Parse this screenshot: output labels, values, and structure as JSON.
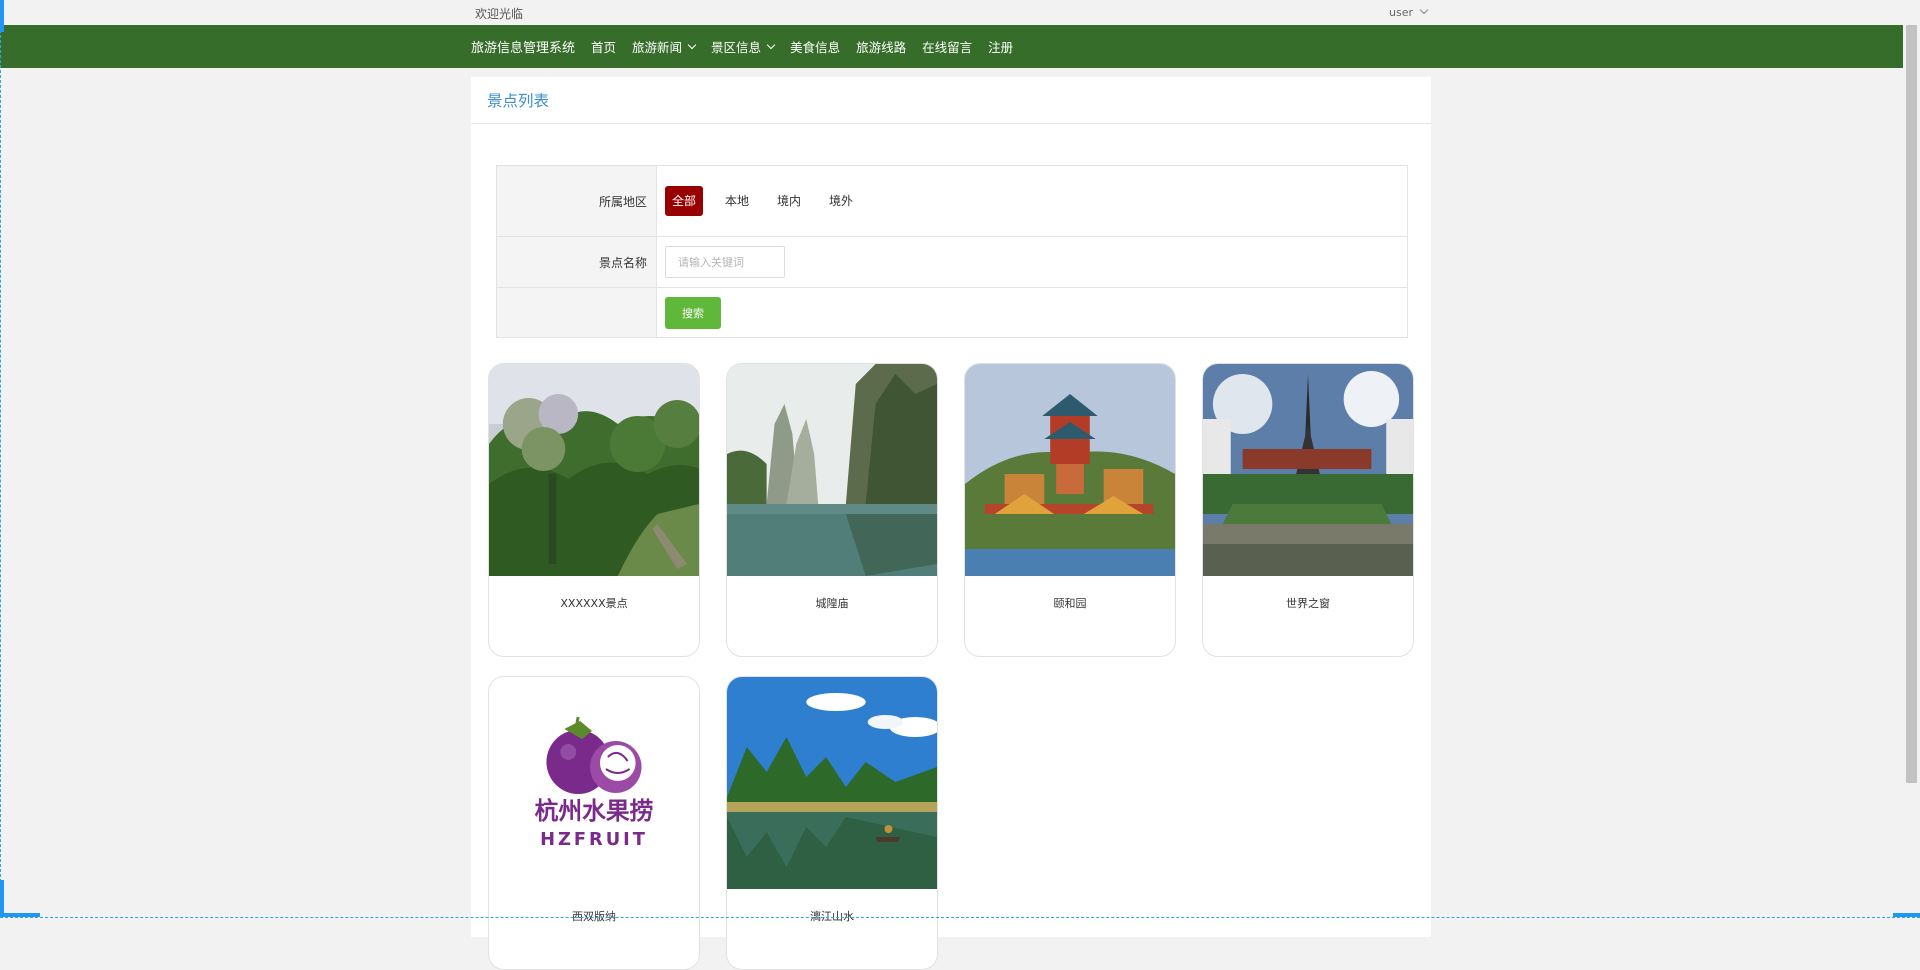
{
  "topbar": {
    "welcome": "欢迎光临",
    "user": "user"
  },
  "nav": {
    "brand": "旅游信息管理系统",
    "items": [
      {
        "label": "首页",
        "dropdown": false
      },
      {
        "label": "旅游新闻",
        "dropdown": true
      },
      {
        "label": "景区信息",
        "dropdown": true
      },
      {
        "label": "美食信息",
        "dropdown": false
      },
      {
        "label": "旅游线路",
        "dropdown": false
      },
      {
        "label": "在线留言",
        "dropdown": false
      },
      {
        "label": "注册",
        "dropdown": false
      }
    ]
  },
  "panel": {
    "title": "景点列表"
  },
  "filter": {
    "region_label": "所属地区",
    "regions": [
      "全部",
      "本地",
      "境内",
      "境外"
    ],
    "active_region": "全部",
    "name_label": "景点名称",
    "name_placeholder": "请输入关键词",
    "name_value": "",
    "search_button": "搜索"
  },
  "cards": [
    {
      "name": "XXXXXX景点",
      "image": "forest-hillside"
    },
    {
      "name": "城隍庙",
      "image": "karst-lake"
    },
    {
      "name": "颐和园",
      "image": "summer-palace"
    },
    {
      "name": "世界之窗",
      "image": "eiffel-tower-park"
    },
    {
      "name": "西双版纳",
      "image": "hzfruit-logo",
      "logo_cn": "杭州水果捞",
      "logo_en": "HZFRUIT"
    },
    {
      "name": "漓江山水",
      "image": "li-river"
    }
  ],
  "colors": {
    "nav": "#366d2a",
    "title": "#3b8fd0",
    "active_tag": "#990000",
    "search_button": "#5fb839",
    "logo": "#7a2a8a"
  }
}
